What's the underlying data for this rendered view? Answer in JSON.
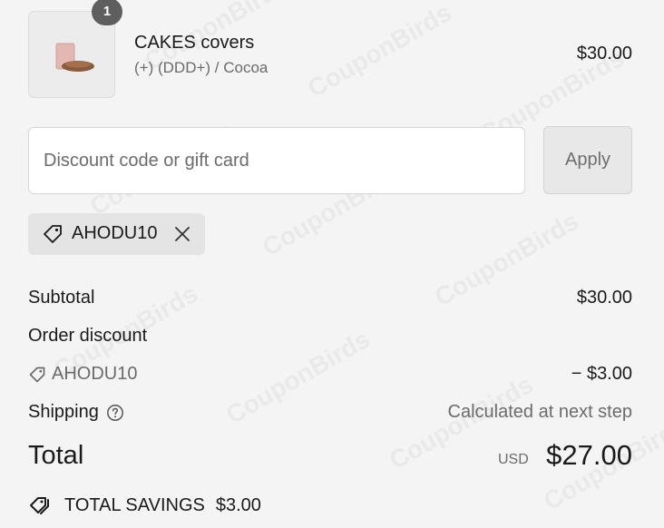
{
  "product": {
    "quantity": "1",
    "name": "CAKES covers",
    "variant": "(+) (DDD+) / Cocoa",
    "price": "$30.00"
  },
  "discount": {
    "placeholder": "Discount code or gift card",
    "value": "",
    "apply_label": "Apply",
    "applied_code": "AHODU10"
  },
  "summary": {
    "subtotal_label": "Subtotal",
    "subtotal_value": "$30.00",
    "order_discount_label": "Order discount",
    "discount_code": "AHODU10",
    "discount_value": "− $3.00",
    "shipping_label": "Shipping",
    "shipping_value": "Calculated at next step",
    "total_label": "Total",
    "currency": "USD",
    "total_value": "$27.00"
  },
  "savings": {
    "label": "TOTAL SAVINGS",
    "value": "$3.00"
  },
  "watermark": "CouponBirds",
  "colors": {
    "background": "#f4f4f4",
    "badge": "#5e5e5e",
    "chip": "#e4e4e4",
    "button": "#e8e8e8"
  }
}
